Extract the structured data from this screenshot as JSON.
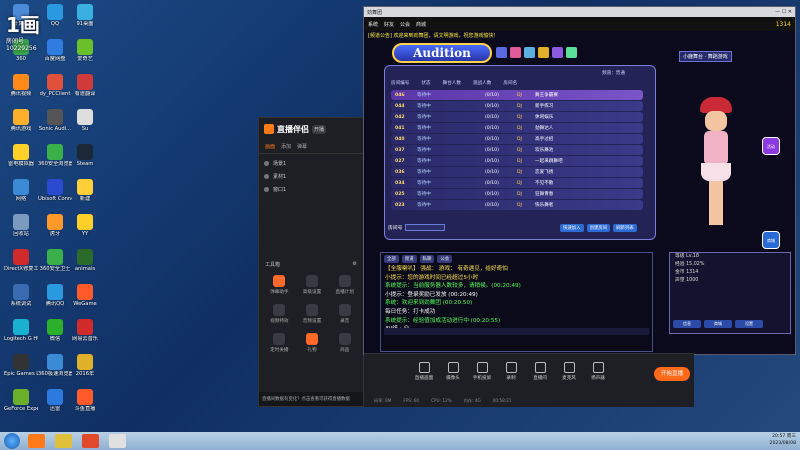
{
  "watermark": {
    "big": "1画",
    "id_label": "房间号",
    "id": "10229256"
  },
  "desktop_icons": [
    {
      "label": "计算机",
      "color": "#4a8ad6"
    },
    {
      "label": "QQ",
      "color": "#2a9ae0"
    },
    {
      "label": "91桌面",
      "color": "#3ab0e0"
    },
    {
      "label": "360",
      "color": "#3aa44a"
    },
    {
      "label": "百度网盘",
      "color": "#2f7de0"
    },
    {
      "label": "爱奇艺",
      "color": "#6ac02a"
    },
    {
      "label": "腾讯视频",
      "color": "#ff8a1a"
    },
    {
      "label": "dy_PCClient",
      "color": "#e0503a"
    },
    {
      "label": "有道翻译",
      "color": "#d03a3a"
    },
    {
      "label": "腾讯游戏",
      "color": "#ffb02a"
    },
    {
      "label": "Sonic Audi...",
      "color": "#555"
    },
    {
      "label": "Su",
      "color": "#ddd"
    },
    {
      "label": "雷电模拟器",
      "color": "#ffd02a"
    },
    {
      "label": "360安全浏览器",
      "color": "#3ab04a"
    },
    {
      "label": "Steam",
      "color": "#1b2838"
    },
    {
      "label": "网络",
      "color": "#3a8ad6"
    },
    {
      "label": "Ubisoft Connect",
      "color": "#2a4ad0"
    },
    {
      "label": "新建",
      "color": "#ffcf3a"
    },
    {
      "label": "回收站",
      "color": "#7a9ac0"
    },
    {
      "label": "虎牙",
      "color": "#ff9a2a"
    },
    {
      "label": "YY",
      "color": "#ffd02a"
    },
    {
      "label": "DirectX修复工具",
      "color": "#d02a2a"
    },
    {
      "label": "360安全卫士",
      "color": "#3ab04a"
    },
    {
      "label": "animals",
      "color": "#2a6a2a"
    },
    {
      "label": "系统调试",
      "color": "#3a6ab0"
    },
    {
      "label": "腾讯QQ",
      "color": "#2a9ae0"
    },
    {
      "label": "WeGame",
      "color": "#ff5a2a"
    },
    {
      "label": "Logitech G HUB",
      "color": "#1ab0d0"
    },
    {
      "label": "微信",
      "color": "#2ab02a"
    },
    {
      "label": "网易云音乐",
      "color": "#d02a2a"
    },
    {
      "label": "Epic Games Launcher",
      "color": "#333"
    },
    {
      "label": "360极速浏览器",
      "color": "#3a8ad6"
    },
    {
      "label": "2016年",
      "color": "#e0b02a"
    },
    {
      "label": "GeForce Experience",
      "color": "#6ab02a"
    },
    {
      "label": "迅雷",
      "color": "#2a7ae0"
    },
    {
      "label": "斗鱼直播",
      "color": "#ff5a2a"
    }
  ],
  "stream_app": {
    "title": "直播伴侣",
    "badge": "开播",
    "tabs": [
      "画面",
      "添加",
      "弹幕"
    ],
    "scenes": [
      "场景1",
      "素材1",
      "窗口1"
    ],
    "toolbox_label": "工具箱",
    "tools": [
      "弹幕助手",
      "高级设置",
      "直播计划",
      "视频特效",
      "音频设置",
      "录音",
      "定时关播",
      "礼物",
      "商品"
    ],
    "footer": "直播间数据有变化？点击查看可获得直播数据"
  },
  "control_bar": {
    "controls": [
      "直播画面",
      "摄像头",
      "手机投屏",
      "录制",
      "直播间",
      "麦克风",
      "扬声器"
    ],
    "go_live": "开始直播",
    "stats": [
      "码率: 8M",
      "FPS: 60",
      "CPU: 12%",
      "内存: 4G",
      "00:58:21"
    ]
  },
  "game": {
    "window_title": "劲舞团",
    "topbar": [
      "系统",
      "好友",
      "公会",
      "商城"
    ],
    "coins": "1314",
    "ticker": "[频道公告] 欢迎来到劲舞团，请文明游戏，祝您游戏愉快！",
    "logo": "Audition",
    "room_list": {
      "headers": [
        "房间编号",
        "状态",
        "舞台人数",
        "观战人数",
        "房间名"
      ],
      "head_info": "频道：普通",
      "rows": [
        {
          "no": "046",
          "st": "等待中",
          "ct": "(0/10)",
          "dj": "DJ",
          "name": "舞王争霸赛",
          "hl": true
        },
        {
          "no": "044",
          "st": "等待中",
          "ct": "(0/10)",
          "dj": "DJ",
          "name": "新手练习",
          "hl": false
        },
        {
          "no": "042",
          "st": "等待中",
          "ct": "(0/10)",
          "dj": "DJ",
          "name": "休闲娱乐",
          "hl": false
        },
        {
          "no": "041",
          "st": "等待中",
          "ct": "(0/10)",
          "dj": "DJ",
          "name": "劲舞达人",
          "hl": false
        },
        {
          "no": "040",
          "st": "等待中",
          "ct": "(0/10)",
          "dj": "DJ",
          "name": "高手过招",
          "hl": false
        },
        {
          "no": "037",
          "st": "等待中",
          "ct": "(0/10)",
          "dj": "DJ",
          "name": "欢乐舞池",
          "hl": false
        },
        {
          "no": "027",
          "st": "等待中",
          "ct": "(0/10)",
          "dj": "DJ",
          "name": "一起来跳舞吧",
          "hl": false
        },
        {
          "no": "036",
          "st": "等待中",
          "ct": "(0/10)",
          "dj": "DJ",
          "name": "恋爱飞扬",
          "hl": false
        },
        {
          "no": "034",
          "st": "等待中",
          "ct": "(0/10)",
          "dj": "DJ",
          "name": "不见不散",
          "hl": false
        },
        {
          "no": "025",
          "st": "等待中",
          "ct": "(0/10)",
          "dj": "DJ",
          "name": "狂舞青春",
          "hl": false
        },
        {
          "no": "023",
          "st": "等待中",
          "ct": "(0/10)",
          "dj": "DJ",
          "name": "快乐舞者",
          "hl": false
        }
      ],
      "input_label": "房间号",
      "buttons": [
        "快速加入",
        "创建房间",
        "刷新列表"
      ]
    },
    "chat": {
      "tabs": [
        "全部",
        "频道",
        "私聊",
        "公会"
      ],
      "lines": [
        {
          "text": "【全服喇叭】 强战：  游戏：  有奇遇见，给好奇怕",
          "cls": "c-yellow"
        },
        {
          "text": "小提示：您的游戏时间已经超过5小时",
          "cls": "c-yellow"
        },
        {
          "text": "系统提示：当前服务器人数较多，请稍候。(00:20:49)",
          "cls": "c-green"
        },
        {
          "text": "小提示：登录奖励已发放 (00:20:49)",
          "cls": "c-white"
        },
        {
          "text": "系统：欢迎来到劲舞团 (00:20:50)",
          "cls": "c-green"
        },
        {
          "text": "每日任务：打卡成功",
          "cls": "c-white"
        },
        {
          "text": "系统提示：经验值加成活动进行中 (00:20:55)",
          "cls": "c-green"
        },
        {
          "text": "AV组 : 😀",
          "cls": "c-white"
        }
      ]
    },
    "profile": {
      "room_name": "小鹿舞台 · 舞蹈游戏",
      "lines": [
        "等级 Lv.18",
        "经验 15.02%",
        "金币 1314",
        "声望 1000"
      ],
      "buttons": [
        "信息",
        "商城",
        "设置"
      ]
    },
    "side_buttons": [
      "活动",
      "商城"
    ]
  },
  "taskbar": {
    "apps": [
      {
        "color": "#ff7a1a"
      },
      {
        "color": "#e0c03a"
      },
      {
        "color": "#e04a2a"
      },
      {
        "color": "#e0e0e0"
      }
    ],
    "time": "20:57 周三",
    "date": "2023/08/08"
  }
}
